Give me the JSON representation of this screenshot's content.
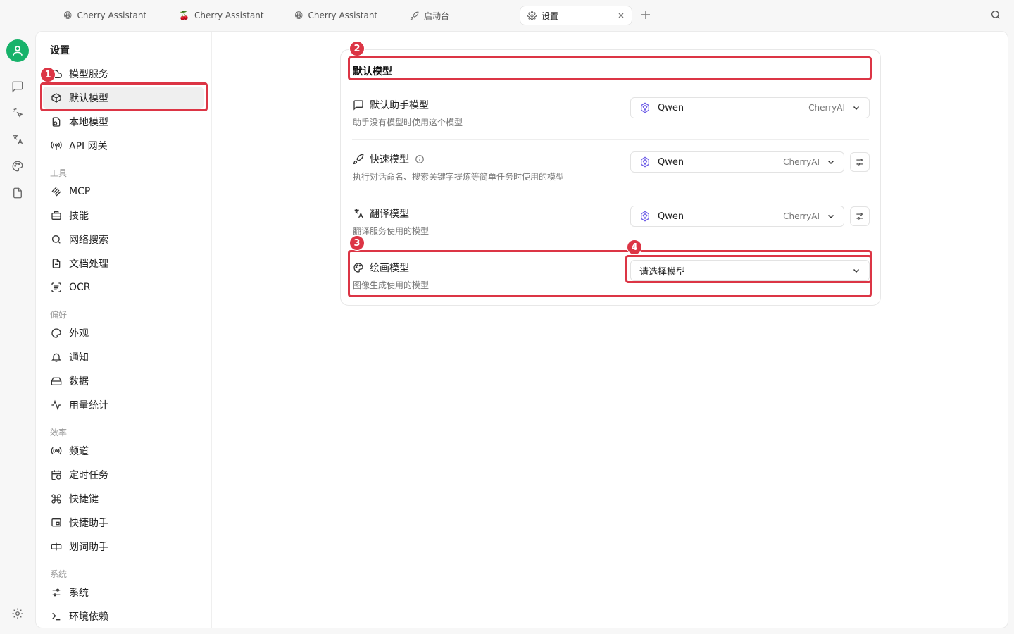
{
  "tabs": [
    {
      "label": "Cherry Assistant",
      "icon": "😀"
    },
    {
      "label": "Cherry Assistant",
      "icon": "🍒"
    },
    {
      "label": "Cherry Assistant",
      "icon": "😀"
    },
    {
      "label": "启动台",
      "icon": "rocket-icon"
    },
    {
      "label": "设置",
      "icon": "gear-icon",
      "active": true
    }
  ],
  "settings_nav": {
    "title": "设置",
    "items": [
      {
        "label": "模型服务"
      },
      {
        "label": "默认模型",
        "active": true
      },
      {
        "label": "本地模型"
      },
      {
        "label": "API 网关"
      }
    ],
    "groups": [
      {
        "label": "工具",
        "items": [
          {
            "label": "MCP"
          },
          {
            "label": "技能"
          },
          {
            "label": "网络搜索"
          },
          {
            "label": "文档处理"
          },
          {
            "label": "OCR"
          }
        ]
      },
      {
        "label": "偏好",
        "items": [
          {
            "label": "外观"
          },
          {
            "label": "通知"
          },
          {
            "label": "数据"
          },
          {
            "label": "用量统计"
          }
        ]
      },
      {
        "label": "效率",
        "items": [
          {
            "label": "频道"
          },
          {
            "label": "定时任务"
          },
          {
            "label": "快捷键"
          },
          {
            "label": "快捷助手"
          },
          {
            "label": "划词助手"
          }
        ]
      },
      {
        "label": "系统",
        "items": [
          {
            "label": "系统"
          },
          {
            "label": "环境依赖"
          }
        ]
      }
    ]
  },
  "content": {
    "title": "默认模型",
    "rows": [
      {
        "title": "默认助手模型",
        "desc": "助手没有模型时使用这个模型",
        "model": "Qwen",
        "provider": "CherryAI"
      },
      {
        "title": "快速模型",
        "desc": "执行对话命名、搜索关键字提炼等简单任务时使用的模型",
        "model": "Qwen",
        "provider": "CherryAI"
      },
      {
        "title": "翻译模型",
        "desc": "翻译服务使用的模型",
        "model": "Qwen",
        "provider": "CherryAI"
      },
      {
        "title": "绘画模型",
        "desc": "图像生成使用的模型",
        "placeholder": "请选择模型"
      }
    ]
  },
  "annotations": [
    "1",
    "2",
    "3",
    "4"
  ],
  "colors": {
    "accent_green": "#17b26a",
    "highlight_red": "#dc3545"
  }
}
